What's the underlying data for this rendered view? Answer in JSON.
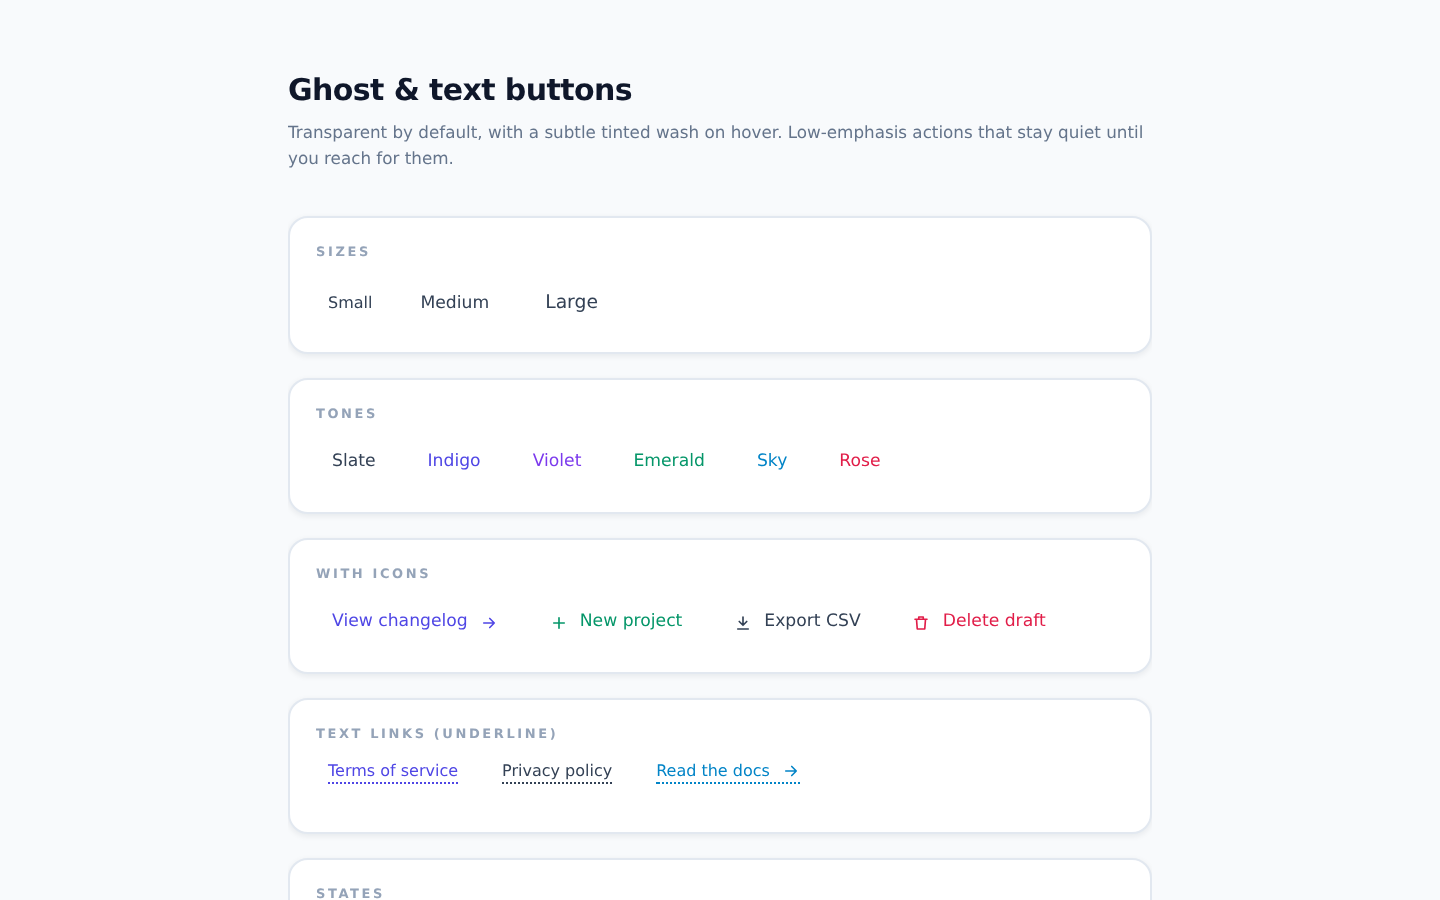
{
  "title": "Ghost & text buttons",
  "description": "Transparent by default, with a subtle tinted wash on hover. Low-emphasis actions that stay quiet until you reach for them.",
  "sections": [
    {
      "label": "SIZES",
      "kind": "ghost",
      "buttons": [
        {
          "label": "Small",
          "kind": "small",
          "color": "#334155"
        },
        {
          "label": "Medium",
          "kind": "medium",
          "color": "#334155"
        },
        {
          "label": "Large",
          "kind": "large",
          "color": "#334155"
        }
      ]
    },
    {
      "label": "TONES",
      "kind": "ghost",
      "buttons": [
        {
          "label": "Slate",
          "color": "#334155"
        },
        {
          "label": "Indigo",
          "color": "#4f46e5"
        },
        {
          "label": "Violet",
          "color": "#7c3aed"
        },
        {
          "label": "Emerald",
          "color": "#059669"
        },
        {
          "label": "Sky",
          "color": "#0284c7"
        },
        {
          "label": "Rose",
          "color": "#e11d48"
        }
      ]
    },
    {
      "label": "WITH ICONS",
      "kind": "ghost",
      "buttons": [
        {
          "label": "View changelog",
          "kind": "arrow",
          "color": "#4f46e5"
        },
        {
          "label": "New project",
          "kind": "plus",
          "color": "#059669"
        },
        {
          "label": "Export CSV",
          "kind": "download",
          "color": "#334155"
        },
        {
          "label": "Delete draft",
          "kind": "trash",
          "color": "#e11d48"
        }
      ]
    },
    {
      "label": "TEXT LINKS (UNDERLINE)",
      "kind": "link",
      "buttons": [
        {
          "label": "Terms of service",
          "color": "#4f46e5"
        },
        {
          "label": "Privacy policy",
          "color": "#334155"
        },
        {
          "label": "Read the docs",
          "kind": "arrow",
          "color": "#0284c7"
        }
      ]
    },
    {
      "label": "STATES"
    }
  ]
}
